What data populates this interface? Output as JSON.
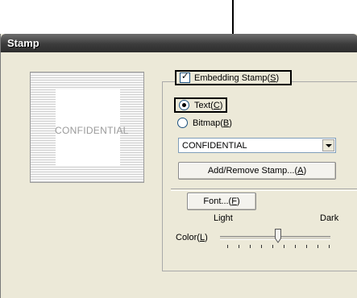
{
  "window": {
    "title": "Stamp"
  },
  "preview": {
    "stamp_text": "CONFIDENTIAL"
  },
  "embedding_stamp": {
    "label": "Embedding Stamp(",
    "accel": "S",
    "label_end": ")",
    "checked": true
  },
  "type_options": {
    "text": {
      "label": "Text(",
      "accel": "C",
      "label_end": ")",
      "selected": true
    },
    "bitmap": {
      "label": "Bitmap(",
      "accel": "B",
      "label_end": ")",
      "selected": false
    }
  },
  "stamp_select": {
    "value": "CONFIDENTIAL"
  },
  "buttons": {
    "add_remove": {
      "label": "Add/Remove Stamp...(",
      "accel": "A",
      "label_end": ")"
    },
    "font": {
      "label": "Font...(",
      "accel": "F",
      "label_end": ")"
    }
  },
  "color": {
    "label": "Color(",
    "accel": "L",
    "label_end": ")",
    "light_label": "Light",
    "dark_label": "Dark",
    "level": 0.5
  },
  "icons": {
    "checkbox": "check-icon",
    "dropdown": "chevron-down-icon"
  }
}
